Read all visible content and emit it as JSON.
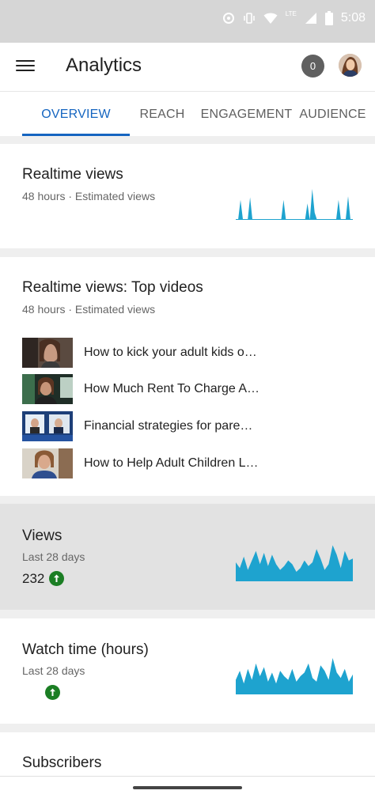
{
  "status_bar": {
    "time": "5:08",
    "network_label": "LTE"
  },
  "app_bar": {
    "title": "Analytics",
    "notification_count": "0"
  },
  "tabs": [
    {
      "label": "OVERVIEW",
      "active": true
    },
    {
      "label": "REACH",
      "active": false
    },
    {
      "label": "ENGAGEMENT",
      "active": false
    },
    {
      "label": "AUDIENCE",
      "active": false
    }
  ],
  "realtime": {
    "title": "Realtime views",
    "subtitle": "48 hours · Estimated views",
    "sparkline": [
      0,
      0,
      0.55,
      0,
      0,
      0,
      0.62,
      0,
      0,
      0,
      0,
      0,
      0,
      0,
      0,
      0,
      0,
      0,
      0,
      0,
      0.55,
      0,
      0,
      0,
      0,
      0,
      0,
      0,
      0,
      0,
      0.45,
      0,
      0.85,
      0.2,
      0,
      0,
      0,
      0,
      0,
      0,
      0,
      0,
      0,
      0.55,
      0,
      0,
      0,
      0.65,
      0,
      0
    ]
  },
  "top_videos": {
    "title": "Realtime views: Top videos",
    "subtitle": "48 hours · Estimated views",
    "items": [
      {
        "title": "How to kick your adult kids o…"
      },
      {
        "title": "How Much Rent To Charge A…"
      },
      {
        "title": "Financial strategies for pare…"
      },
      {
        "title": "How to Help Adult Children L…"
      }
    ]
  },
  "views": {
    "title": "Views",
    "subtitle": "Last 28 days",
    "value": "232",
    "trend": "up",
    "sparkline": [
      0.5,
      0.35,
      0.65,
      0.3,
      0.55,
      0.8,
      0.45,
      0.75,
      0.4,
      0.7,
      0.45,
      0.3,
      0.4,
      0.55,
      0.45,
      0.25,
      0.35,
      0.55,
      0.4,
      0.5,
      0.85,
      0.6,
      0.3,
      0.45,
      0.95,
      0.7,
      0.35,
      0.8,
      0.55,
      0.6
    ]
  },
  "watch_time": {
    "title": "Watch time (hours)",
    "subtitle": "Last 28 days",
    "trend": "up",
    "sparkline": [
      0.4,
      0.65,
      0.3,
      0.7,
      0.4,
      0.85,
      0.5,
      0.75,
      0.35,
      0.6,
      0.3,
      0.65,
      0.5,
      0.4,
      0.7,
      0.35,
      0.5,
      0.6,
      0.85,
      0.45,
      0.35,
      0.8,
      0.65,
      0.4,
      1.0,
      0.6,
      0.45,
      0.7,
      0.35,
      0.55
    ]
  },
  "subscribers": {
    "title": "Subscribers"
  },
  "colors": {
    "accent": "#1565c0",
    "spark": "#1ea3cf",
    "trend_up": "#1b7e24"
  }
}
